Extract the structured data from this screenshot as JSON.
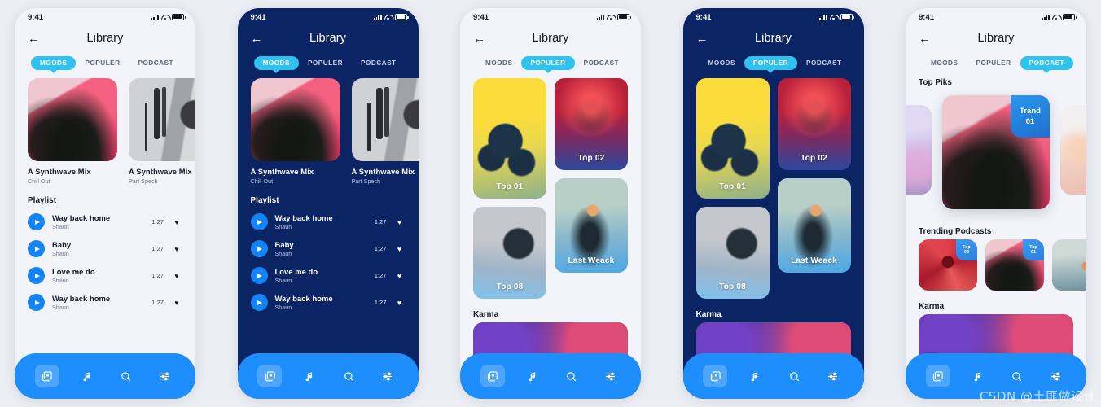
{
  "meta": {
    "watermark": "CSDN @土匪做设计",
    "accent_cyan": "#2fc2ef",
    "accent_blue": "#1d8efb",
    "dark_bg": "#0b2463",
    "light_bg": "#f3f4fa",
    "page_bg": "#eceef4"
  },
  "status_bar": {
    "time": "9:41",
    "signal_icon": "cellular-signal-icon",
    "wifi_icon": "wifi-icon",
    "battery_icon": "battery-icon"
  },
  "header": {
    "back_icon": "back-arrow-icon",
    "title": "Library"
  },
  "tabs": [
    {
      "id": "moods",
      "label": "MOODS"
    },
    {
      "id": "populer",
      "label": "POPULER"
    },
    {
      "id": "podcast",
      "label": "PODCAST"
    }
  ],
  "bottom_nav": [
    {
      "id": "library",
      "icon": "library-stack-icon",
      "active": true
    },
    {
      "id": "music",
      "icon": "music-note-icon",
      "active": false
    },
    {
      "id": "search",
      "icon": "search-icon",
      "active": false
    },
    {
      "id": "settings",
      "icon": "sliders-icon",
      "active": false
    }
  ],
  "moods_screen": {
    "cards": [
      {
        "title": "A Synthwave Mix",
        "subtitle": "Chill Out",
        "art": "art-pinkgirl"
      },
      {
        "title": "A Synthwave Mix",
        "subtitle": "Part Spech",
        "art": "art-mic"
      }
    ],
    "playlist_title": "Playlist",
    "tracks": [
      {
        "name": "Way back home",
        "artist": "Shaun",
        "duration": "1:27",
        "fav_icon": "heart-icon",
        "fav": "♥"
      },
      {
        "name": "Baby",
        "artist": "Shaun",
        "duration": "1:27",
        "fav_icon": "heart-icon",
        "fav": "♥"
      },
      {
        "name": "Love me do",
        "artist": "Shaun",
        "duration": "1:27",
        "fav_icon": "heart-icon",
        "fav": "♥"
      },
      {
        "name": "Way back home",
        "artist": "Shaun",
        "duration": "1:27",
        "fav_icon": "heart-icon",
        "fav": "♥"
      }
    ]
  },
  "populer_screen": {
    "cards": [
      {
        "label": "Top 01",
        "art": "art-yellowhp"
      },
      {
        "label": "Top 02",
        "art": "art-redneon"
      },
      {
        "label": "Top 08",
        "art": "art-shout"
      },
      {
        "label": "Last Weack",
        "art": "art-hand"
      }
    ],
    "karma_title": "Karma",
    "karma_art": "art-crowd"
  },
  "podcast_screen": {
    "top_piks_title": "Top Piks",
    "carousel": {
      "left_art": "art-purple",
      "right_art": "art-flame",
      "main_art": "art-pinkgirl",
      "badge_line1": "Trand",
      "badge_line2": "01"
    },
    "trending_title": "Trending Podcasts",
    "trending": [
      {
        "art": "art-redfan",
        "badge_line1": "Top",
        "badge_line2": "02"
      },
      {
        "art": "art-pinkgirl",
        "badge_line1": "Top",
        "badge_line2": "01"
      },
      {
        "art": "art-smoke",
        "badge_line1": "",
        "badge_line2": ""
      }
    ],
    "karma_title": "Karma",
    "karma_art": "art-crowd"
  },
  "phones": [
    {
      "id": "phone-1",
      "theme": "light",
      "screen": "moods",
      "active_tab": 0
    },
    {
      "id": "phone-2",
      "theme": "dark",
      "screen": "moods",
      "active_tab": 0
    },
    {
      "id": "phone-3",
      "theme": "light",
      "screen": "populer",
      "active_tab": 1
    },
    {
      "id": "phone-4",
      "theme": "dark",
      "screen": "populer",
      "active_tab": 1
    },
    {
      "id": "phone-5",
      "theme": "light",
      "screen": "podcast",
      "active_tab": 2
    }
  ]
}
